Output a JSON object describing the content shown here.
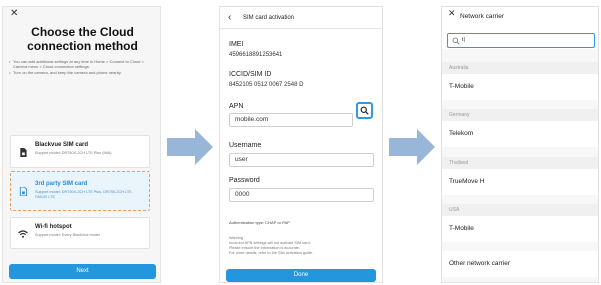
{
  "screen1": {
    "close_icon": "close-icon",
    "title": "Choose the Cloud connection method",
    "info": [
      "You can add additional settings at any time in Home > Connect to Cloud > Camera menu > Cloud connection settings.",
      "Turn on the camera, and keep the camera and phone nearby."
    ],
    "options": [
      {
        "icon": "sim-card-icon",
        "title": "Blackvue SIM card",
        "subtitle": "Support model: DR750X-2CH LTE Plus (IMA)"
      },
      {
        "icon": "sim-card-icon",
        "title": "3rd party SIM card",
        "subtitle": "Support model: DR750X-2CH LTE Plus, DR750-2CH LTE, DM100 LTE"
      },
      {
        "icon": "wifi-icon",
        "title": "Wi-fi hotspot",
        "subtitle": "Support model: Every BlackVue model"
      }
    ],
    "next_label": "Next"
  },
  "screen2": {
    "title": "SIM card activation",
    "imei_label": "IMEI",
    "imei_value": "4596618891253641",
    "iccid_label": "ICCID/SIM ID",
    "iccid_value": "8452105 0512 0067 2548 D",
    "apn_label": "APN",
    "apn_value": "mobile.com",
    "username_label": "Username",
    "username_value": "user",
    "password_label": "Password",
    "password_value": "0000",
    "auth_text": "Authentication type: CHAP or PAP",
    "warning_lines": [
      "Warning",
      "Incorrect APN settings will not activate SIM card.",
      "Please ensure the information is accurate.",
      "For more details, refer to the SIM activation guide."
    ],
    "done_label": "Done"
  },
  "screen3": {
    "title": "Network carrier",
    "search_value": "t|",
    "groups": [
      {
        "name": "Australia",
        "item": "T-Mobile"
      },
      {
        "name": "Germany",
        "item": "Telekom"
      },
      {
        "name": "Thailand",
        "item": "TrueMove H"
      },
      {
        "name": "USA",
        "item": "T-Mobile"
      }
    ],
    "other_label": "Other network carrier"
  },
  "colors": {
    "accent": "#2397dd",
    "arrow": "#98b7d8",
    "selected_border": "#e79e5a"
  }
}
